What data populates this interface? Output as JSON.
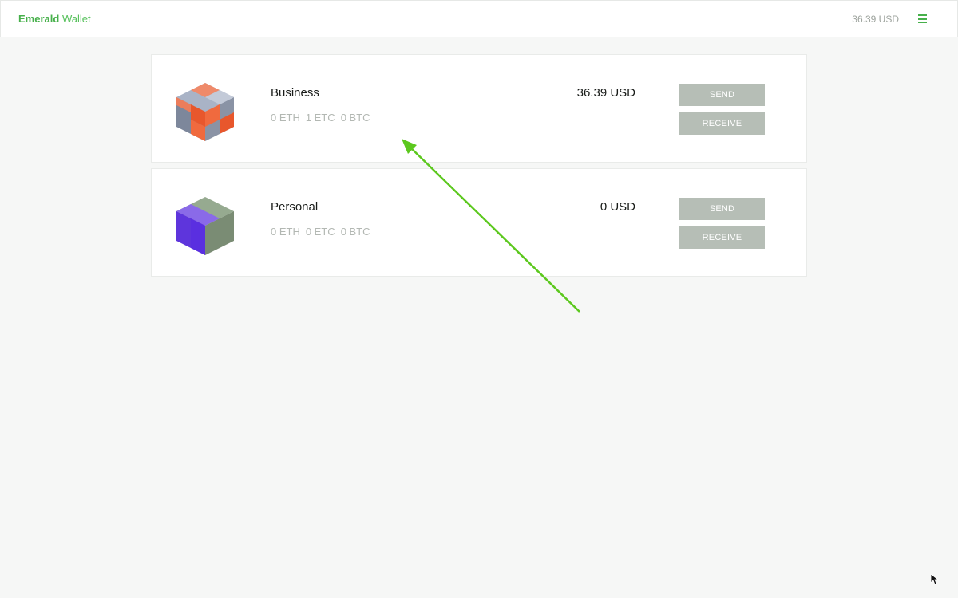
{
  "header": {
    "brand_strong": "Emerald",
    "brand_light": "Wallet",
    "total": "36.39 USD",
    "menu_icon": "hamburger-menu-icon"
  },
  "accounts": [
    {
      "name": "Business",
      "balances": [
        "0 ETH",
        "1 ETC",
        "0 BTC"
      ],
      "fiat": "36.39 USD",
      "send_label": "SEND",
      "receive_label": "RECEIVE",
      "avatar_icon": "identicon-cube-icon"
    },
    {
      "name": "Personal",
      "balances": [
        "0 ETH",
        "0 ETC",
        "0 BTC"
      ],
      "fiat": "0 USD",
      "send_label": "SEND",
      "receive_label": "RECEIVE",
      "avatar_icon": "identicon-cube-icon"
    }
  ],
  "colors": {
    "brand": "#47b04b",
    "button": "#b6beb6",
    "background": "#f6f7f6",
    "annotation_arrow": "#5cc81e"
  }
}
